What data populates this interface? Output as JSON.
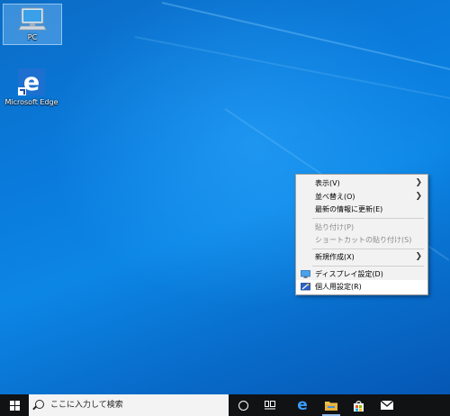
{
  "desktop": {
    "icons": [
      {
        "label": "PC",
        "icon": "computer-icon",
        "selected": true
      },
      {
        "label": "Microsoft Edge",
        "icon": "edge-icon",
        "selected": false
      }
    ]
  },
  "context_menu": {
    "items": [
      {
        "label": "表示(V)",
        "submenu": true
      },
      {
        "label": "並べ替え(O)",
        "submenu": true
      },
      {
        "label": "最新の情報に更新(E)"
      },
      {
        "label": "貼り付け(P)",
        "disabled": true
      },
      {
        "label": "ショートカットの貼り付け(S)",
        "disabled": true
      },
      {
        "label": "新規作成(X)",
        "submenu": true
      },
      {
        "label": "ディスプレイ設定(D)",
        "icon": "display-settings-icon"
      },
      {
        "label": "個人用設定(R)",
        "icon": "personalize-icon",
        "highlighted": true
      }
    ]
  },
  "taskbar": {
    "search_placeholder": "ここに入力して検索",
    "apps": [
      "cortana-icon",
      "task-view-icon",
      "edge-icon",
      "file-explorer-icon",
      "store-icon",
      "mail-icon"
    ]
  },
  "colors": {
    "accent": "#0078d7",
    "taskbar": "#101214"
  }
}
